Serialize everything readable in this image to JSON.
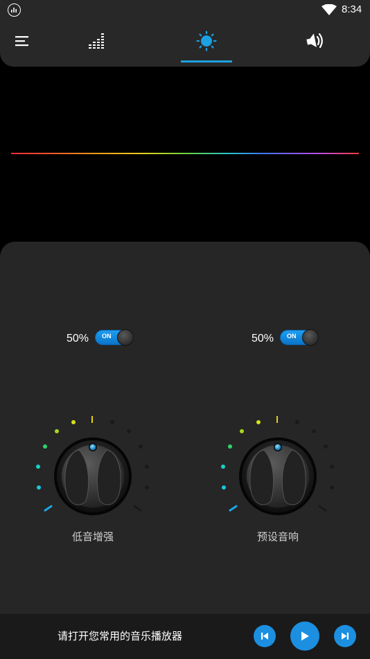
{
  "status_bar": {
    "time": "8:34",
    "app_icon": "equalizer-app-icon",
    "wifi_icon": "wifi-icon"
  },
  "nav": {
    "menu_icon": "menu-icon",
    "tabs": [
      {
        "name": "equalizer",
        "icon": "equalizer-bars-icon",
        "selected": false
      },
      {
        "name": "effect",
        "icon": "sun-effect-icon",
        "selected": true
      },
      {
        "name": "volume",
        "icon": "speaker-volume-icon",
        "selected": false
      }
    ],
    "accent_color": "#1ba1e2"
  },
  "effects": {
    "bass_boost": {
      "percent": "50%",
      "toggle_label": "ON",
      "enabled": true,
      "label": "低音增强",
      "level": 0
    },
    "preset_reverb": {
      "percent": "50%",
      "toggle_label": "ON",
      "enabled": true,
      "label": "预设音响",
      "level": 0
    }
  },
  "player": {
    "prompt": "请打开您常用的音乐播放器",
    "prev_icon": "skip-previous-icon",
    "play_icon": "play-icon",
    "next_icon": "skip-next-icon",
    "button_color": "#1c8fe0"
  }
}
